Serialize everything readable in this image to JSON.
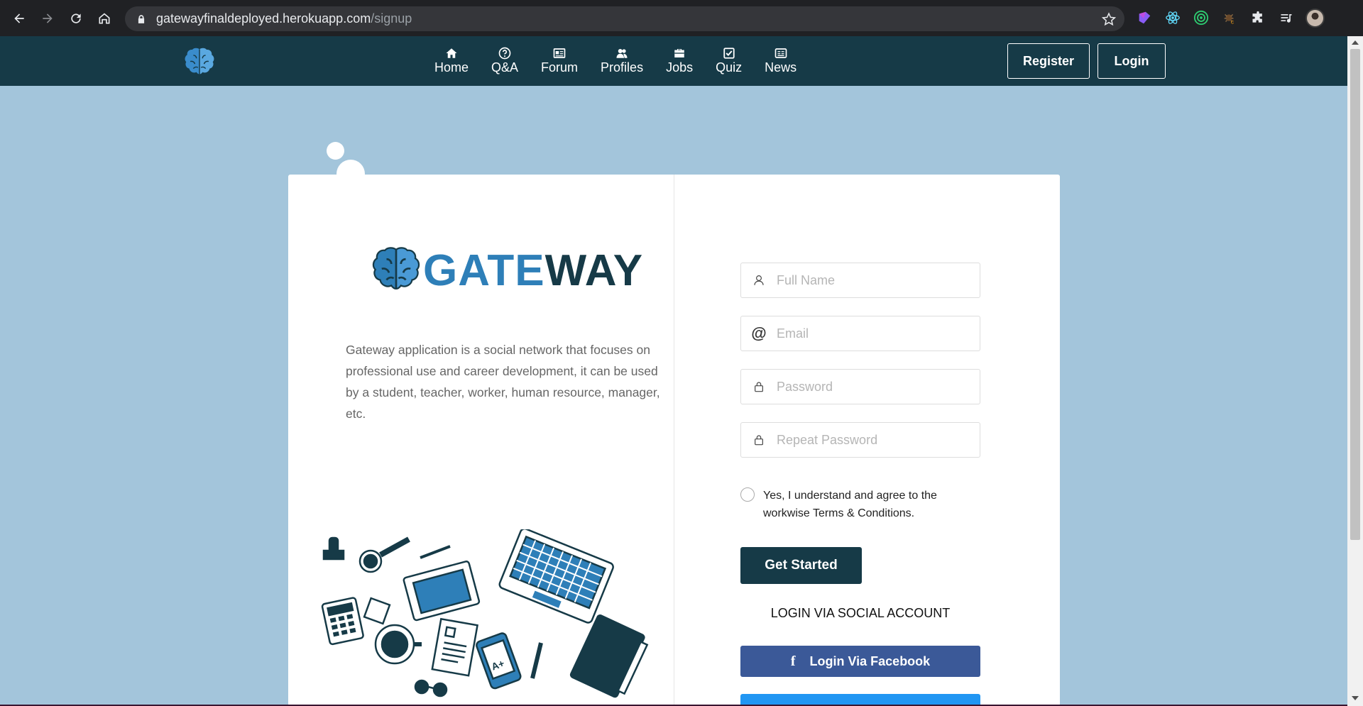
{
  "browser": {
    "url_host": "gatewayfinaldeployed.herokuapp.com",
    "url_path": "/signup",
    "icons": [
      "back-icon",
      "forward-icon",
      "reload-icon",
      "home-icon",
      "lock-icon",
      "star-icon",
      "extensions-icon",
      "media-icon",
      "profile-avatar"
    ]
  },
  "nav": {
    "items": [
      {
        "label": "Home",
        "icon": "home-icon"
      },
      {
        "label": "Q&A",
        "icon": "question-icon"
      },
      {
        "label": "Forum",
        "icon": "forum-icon"
      },
      {
        "label": "Profiles",
        "icon": "profiles-icon"
      },
      {
        "label": "Jobs",
        "icon": "briefcase-icon"
      },
      {
        "label": "Quiz",
        "icon": "checkbox-icon"
      },
      {
        "label": "News",
        "icon": "newspaper-icon"
      }
    ],
    "register_label": "Register",
    "login_label": "Login"
  },
  "card": {
    "logo_gate": "GATE",
    "logo_way": "WAY",
    "description": "Gateway application is a social network that focuses on professional use and career development, it can be used by a student, teacher, worker, human resource, manager, etc."
  },
  "form": {
    "full_name_placeholder": "Full Name",
    "email_placeholder": "Email",
    "password_placeholder": "Password",
    "repeat_password_placeholder": "Repeat Password",
    "terms_text": "Yes, I understand and agree to the workwise Terms & Conditions.",
    "submit_label": "Get Started",
    "social_title": "LOGIN VIA SOCIAL ACCOUNT",
    "facebook_label": "Login Via Facebook"
  },
  "colors": {
    "navbar": "#163a47",
    "background": "#a3c5db",
    "facebook": "#3b5998",
    "twitter": "#2196f3",
    "logo_blue": "#2e7fb8"
  }
}
